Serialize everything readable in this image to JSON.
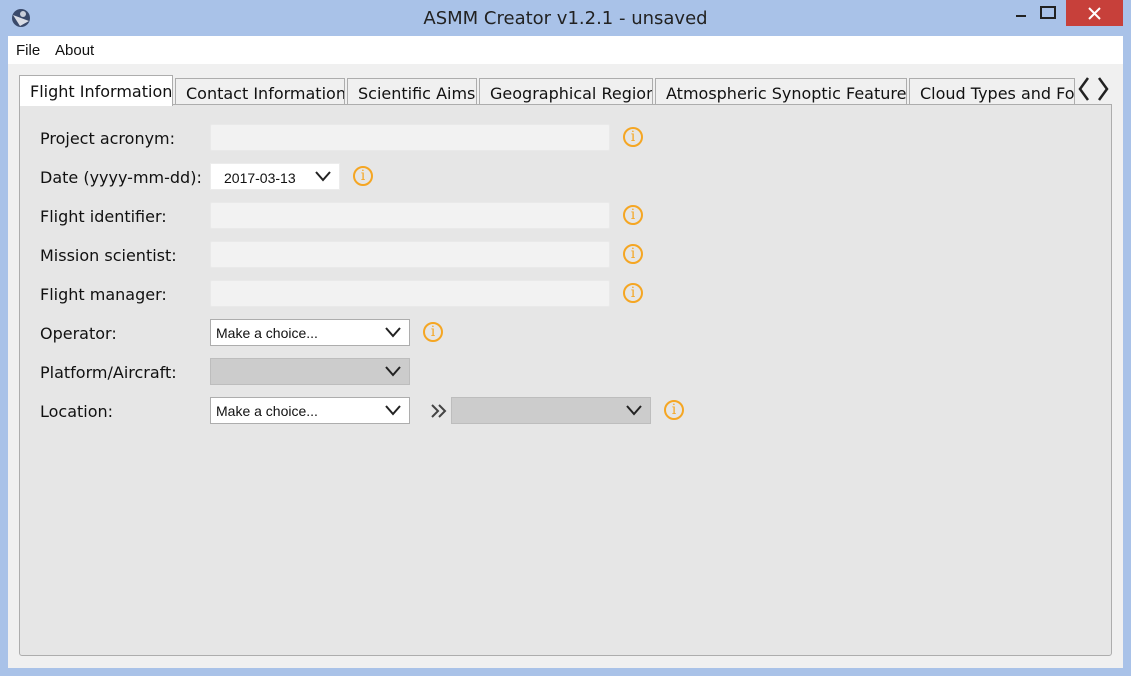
{
  "window": {
    "title": "ASMM Creator v1.2.1 - unsaved"
  },
  "menu": [
    "File",
    "About"
  ],
  "tabs": [
    {
      "label": "Flight Information",
      "active": true
    },
    {
      "label": "Contact Information"
    },
    {
      "label": "Scientific Aims"
    },
    {
      "label": "Geographical Region"
    },
    {
      "label": "Atmospheric Synoptic Features"
    },
    {
      "label": "Cloud Types and Forms"
    }
  ],
  "fields": {
    "project_acronym": {
      "label": "Project acronym:",
      "value": ""
    },
    "date": {
      "label": "Date (yyyy-mm-dd):",
      "value": "2017-03-13"
    },
    "flight_identifier": {
      "label": "Flight identifier:",
      "value": ""
    },
    "mission_scientist": {
      "label": "Mission scientist:",
      "value": ""
    },
    "flight_manager": {
      "label": "Flight manager:",
      "value": ""
    },
    "operator": {
      "label": "Operator:",
      "value": "Make a choice..."
    },
    "platform": {
      "label": "Platform/Aircraft:",
      "value": ""
    },
    "location": {
      "label": "Location:",
      "value": "Make a choice...",
      "sub_value": ""
    }
  },
  "icons": {
    "info": "info-icon",
    "chevron": "chevron-down-icon",
    "forward": "double-chevron-right-icon",
    "tab_left": "chevron-left-icon",
    "tab_right": "chevron-right-icon"
  },
  "info_glyph": "i",
  "colors": {
    "accent_info": "#f5a623",
    "titlebar": "#a9c2e8",
    "close_button": "#c7403a"
  }
}
